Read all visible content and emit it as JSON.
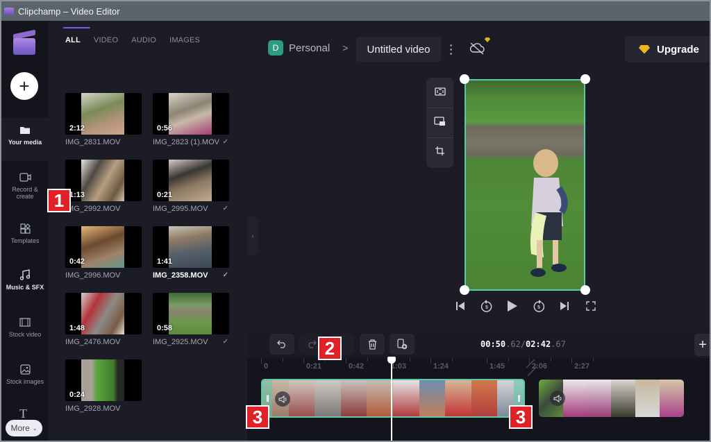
{
  "window": {
    "title": "Clipchamp – Video Editor"
  },
  "rail": {
    "add_label": "+",
    "items": [
      {
        "label": "Your media",
        "icon": "folder-icon"
      },
      {
        "label": "Record & create",
        "icon": "camera-icon"
      },
      {
        "label": "Templates",
        "icon": "templates-icon"
      },
      {
        "label": "Music & SFX",
        "icon": "music-icon"
      },
      {
        "label": "Stock video",
        "icon": "film-icon"
      },
      {
        "label": "Stock images",
        "icon": "image-icon"
      },
      {
        "label": "Text",
        "icon": "text-icon"
      }
    ],
    "more_label": "More",
    "more_chevron": "⌄"
  },
  "media": {
    "tabs": [
      "ALL",
      "VIDEO",
      "AUDIO",
      "IMAGES"
    ],
    "active_tab": "ALL",
    "items": [
      {
        "name": "IMG_2831.MOV",
        "duration": "2:12",
        "added": false
      },
      {
        "name": "IMG_2823 (1).MOV",
        "duration": "0:56",
        "added": true
      },
      {
        "name": "IMG_2992.MOV",
        "duration": "1:13",
        "added": false
      },
      {
        "name": "IMG_2995.MOV",
        "duration": "0:21",
        "added": true
      },
      {
        "name": "IMG_2996.MOV",
        "duration": "0:42",
        "added": false
      },
      {
        "name": "IMG_2358.MOV",
        "duration": "1:41",
        "added": true,
        "highlighted": true
      },
      {
        "name": "IMG_2476.MOV",
        "duration": "1:48",
        "added": false
      },
      {
        "name": "IMG_2925.MOV",
        "duration": "0:58",
        "added": true
      },
      {
        "name": "IMG_2928.MOV",
        "duration": "0:24",
        "added": false
      }
    ],
    "check_glyph": "✓"
  },
  "header": {
    "avatar_initial": "D",
    "workspace": "Personal",
    "separator": ">",
    "project_title": "Untitled video",
    "upgrade_label": "Upgrade"
  },
  "player": {
    "controls": [
      "skip-back",
      "rewind-5",
      "play",
      "forward-5",
      "skip-forward",
      "fullscreen"
    ],
    "skip_seconds": "5"
  },
  "timeline": {
    "current_time": "00:50",
    "current_frac": ".62",
    "separator": "/",
    "total_time": "02:42",
    "total_frac": ".67",
    "ruler_ticks": [
      "0",
      "0:21",
      "0:42",
      "1:03",
      "1:24",
      "1:45",
      "2:06",
      "2:27"
    ],
    "playhead_time_s": 50.62,
    "total_s": 162.67
  },
  "annotations": [
    "1",
    "2",
    "3",
    "3"
  ],
  "colors": {
    "accent": "#7a5be0",
    "selection": "#5cc9a7",
    "callout": "#e02127",
    "workspace_avatar": "#2e9c82",
    "premium_gem": "#f2b71c"
  }
}
